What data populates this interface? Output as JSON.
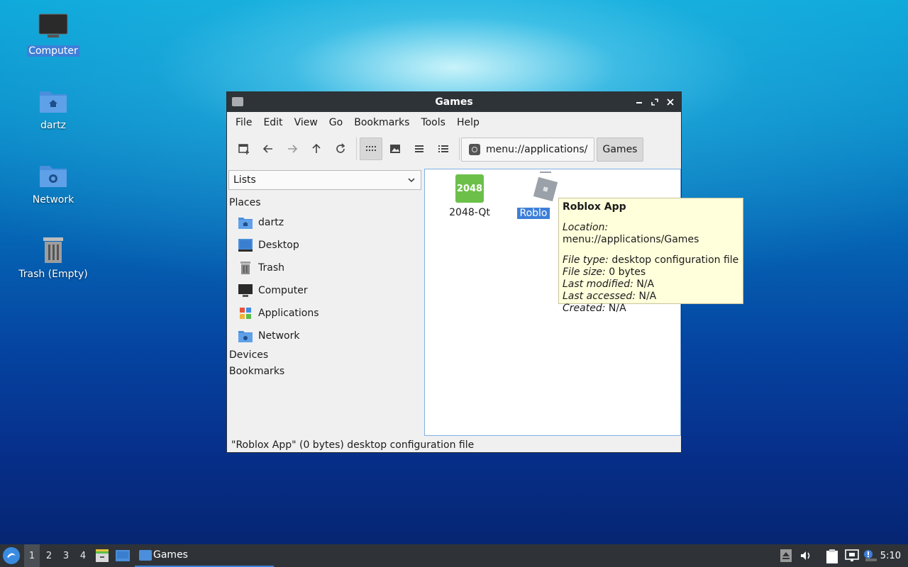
{
  "desktop": {
    "icons": [
      {
        "label": "Computer",
        "icon": "monitor-icon",
        "selected": true
      },
      {
        "label": "dartz",
        "icon": "home-folder-icon"
      },
      {
        "label": "Network",
        "icon": "network-folder-icon"
      },
      {
        "label": "Trash (Empty)",
        "icon": "trash-icon"
      }
    ]
  },
  "window": {
    "title": "Games",
    "menu": [
      "File",
      "Edit",
      "View",
      "Go",
      "Bookmarks",
      "Tools",
      "Help"
    ],
    "toolbar": {
      "buttons": [
        "new-tab-icon",
        "back-arrow-icon",
        "forward-arrow-icon",
        "up-arrow-icon",
        "reload-icon",
        "icon-view-icon",
        "thumbnail-view-icon",
        "compact-view-icon",
        "detailed-list-icon"
      ],
      "path": "menu://applications/",
      "breadcrumb": "Games"
    },
    "sidebar": {
      "mode": "Lists",
      "sections": {
        "places": "Places",
        "devices": "Devices",
        "bookmarks": "Bookmarks"
      },
      "places": [
        {
          "label": "dartz",
          "icon": "home-folder-icon"
        },
        {
          "label": "Desktop",
          "icon": "desktop-icon"
        },
        {
          "label": "Trash",
          "icon": "trash-icon"
        },
        {
          "label": "Computer",
          "icon": "monitor-icon"
        },
        {
          "label": "Applications",
          "icon": "applications-icon"
        },
        {
          "label": "Network",
          "icon": "network-folder-icon"
        }
      ]
    },
    "files": [
      {
        "name": "2048-Qt",
        "icon_text": "2048",
        "icon_color": "#6cc04a"
      },
      {
        "name": "Roblox App",
        "visible_name": "Roblo",
        "icon_color": "#9aa1a8",
        "selected": true
      }
    ],
    "status": "\"Roblox App\" (0 bytes) desktop configuration file"
  },
  "tooltip": {
    "title": "Roblox App",
    "location_label": "Location:",
    "location": "menu://applications/Games",
    "file_type_label": "File type:",
    "file_type": "desktop configuration file",
    "file_size_label": "File size:",
    "file_size": "0 bytes",
    "modified_label": "Last modified:",
    "modified": "N/A",
    "accessed_label": "Last accessed:",
    "accessed": "N/A",
    "created_label": "Created:",
    "created": "N/A"
  },
  "taskbar": {
    "workspaces": [
      "1",
      "2",
      "3",
      "4"
    ],
    "current_workspace": "1",
    "task": "Games",
    "clock": "5:10"
  },
  "colors": {
    "accent": "#3d7fd8",
    "titlebar": "#2e3338",
    "tooltip_bg": "#ffffdc"
  }
}
